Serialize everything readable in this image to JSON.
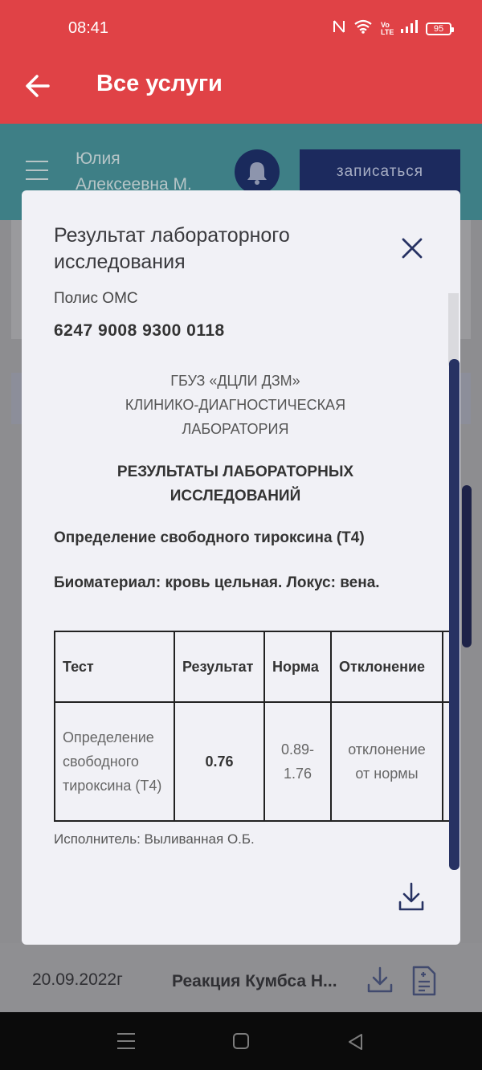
{
  "status_bar": {
    "time": "08:41",
    "nfc_icon": "nfc-icon",
    "wifi_icon": "wifi-icon",
    "volte_label": "Vo\nLTE",
    "signal_icon": "signal-icon",
    "battery": "95"
  },
  "app_bar": {
    "title": "Все услуги",
    "back_icon": "arrow-left-icon"
  },
  "background": {
    "user_name_line1": "Юлия",
    "user_name_line2": "Алексеевна М.",
    "signup_label": "записаться",
    "row": {
      "date": "20.09.2022г",
      "name": "Реакция Кумбса Н..."
    }
  },
  "modal": {
    "title": "Результат лабораторного исследования",
    "polis_label": "Полис ОМС",
    "polis_number": "6247 9008 9300 0118",
    "lab_line1": "ГБУЗ «ДЦЛИ ДЗМ»",
    "lab_line2": "КЛИНИКО-ДИАГНОСТИЧЕСКАЯ",
    "lab_line3": "ЛАБОРАТОРИЯ",
    "results_heading": "РЕЗУЛЬТАТЫ ЛАБОРАТОРНЫХ ИССЛЕДОВАНИЙ",
    "test_name": "Определение свободного тироксина (Т4)",
    "biomaterial": "Биоматериал: кровь цельная. Локус: вена.",
    "table": {
      "headers": [
        "Тест",
        "Результат",
        "Норма",
        "Отклонение"
      ],
      "row": {
        "test": "Определение свободного тироксина (Т4)",
        "result": "0.76",
        "norm": "0.89-1.76",
        "deviation": "отклонение от нормы"
      }
    },
    "executor": "Исполнитель: Выливанная О.Б."
  },
  "colors": {
    "accent_red": "#e04246",
    "teal": "#3e7f86",
    "navy": "#273263"
  }
}
